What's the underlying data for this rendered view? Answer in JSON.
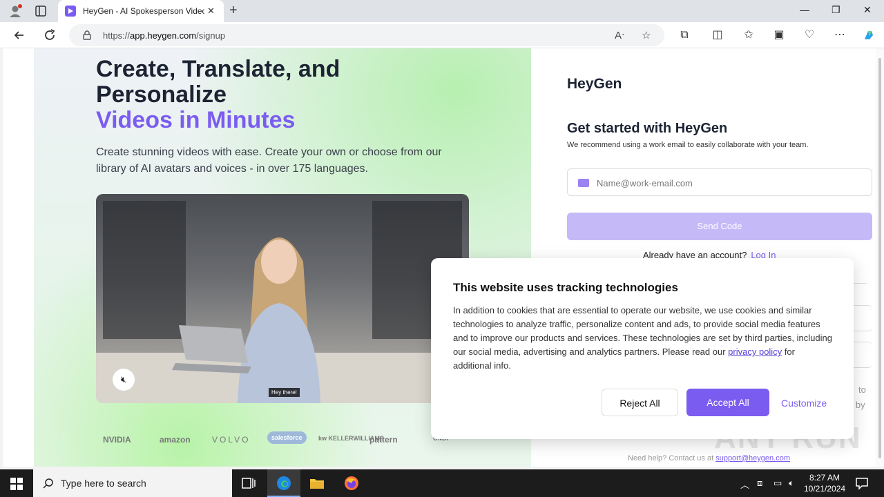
{
  "browser": {
    "tab_title": "HeyGen - AI Spokesperson Video",
    "url_prefix": "https://",
    "url_host": "app.heygen.com",
    "url_path": "/signup",
    "close_tab_glyph": "✕",
    "new_tab_glyph": "+",
    "min_glyph": "—",
    "max_glyph": "❐",
    "close_glyph": "✕"
  },
  "hero": {
    "headline_line1": "Create, Translate, and",
    "headline_line2": "Personalize",
    "headline_accent": "Videos in Minutes",
    "subtext": "Create stunning videos with ease. Create your own or choose from our library of AI avatars and voices - in over 175 languages.",
    "video_caption": "Hey there!",
    "logos": [
      "NVIDIA",
      "amazon",
      "VOLVO",
      "salesforce",
      "kw KELLERWILLIAMS",
      "pattern",
      "UNDP"
    ]
  },
  "signup": {
    "brand": "HeyGen",
    "title": "Get started with HeyGen",
    "subtitle": "We recommend using a work email to easily collaborate with your team.",
    "email_placeholder": "Name@work-email.com",
    "send_code": "Send Code",
    "already_text": "Already have an account?",
    "login_link": "Log In",
    "partial_text_1": "to",
    "partial_text_2": "d by",
    "help_text": "Need help? Contact us at",
    "help_email": "support@heygen.com"
  },
  "cookie_banner": {
    "title": "This website uses tracking technologies",
    "body_before": "In addition to cookies that are essential to operate our website, we use cookies and similar technologies to analyze traffic, personalize content and ads, to provide social media features and to improve our products and services. These technologies are set by third parties, including our social media, advertising and analytics partners. Please read our ",
    "privacy_link": "privacy policy",
    "body_after": " for additional info.",
    "reject": "Reject All",
    "accept": "Accept All",
    "customize": "Customize"
  },
  "watermark": "ANY RUN",
  "taskbar": {
    "search_placeholder": "Type here to search",
    "time": "8:27 AM",
    "date": "10/21/2024"
  },
  "colors": {
    "accent": "#7b5cf0",
    "send_disabled": "#c6b9f8"
  }
}
